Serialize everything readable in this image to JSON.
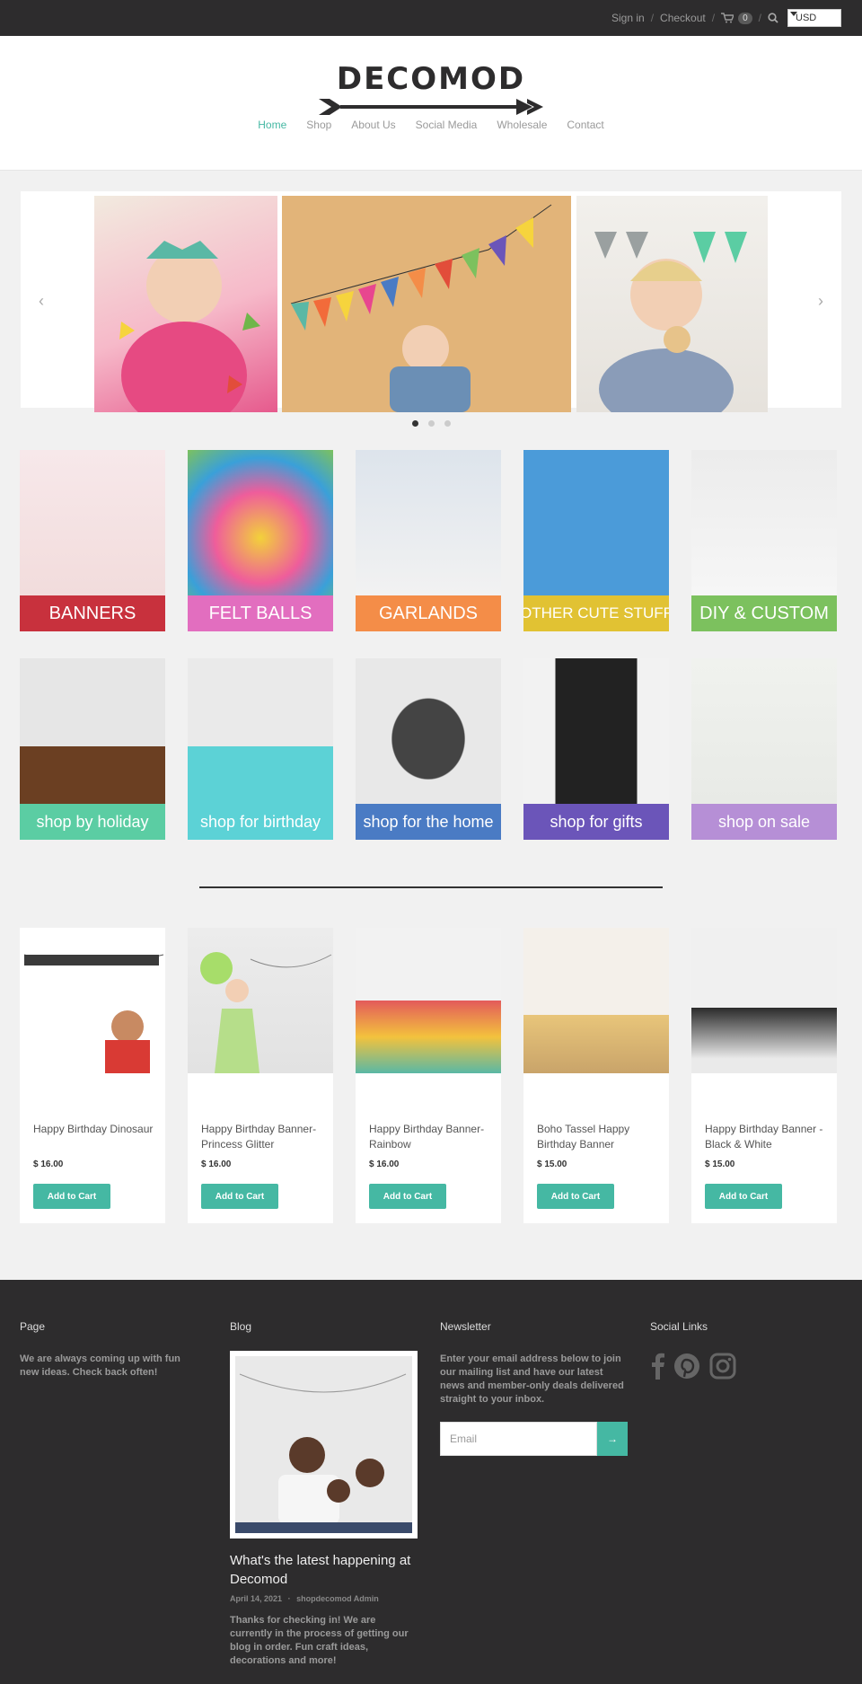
{
  "topbar": {
    "sign_in": "Sign in",
    "sep": "/",
    "checkout": "Checkout",
    "cart_count": "0",
    "currency": "USD"
  },
  "logo": {
    "text": "DECOMOD"
  },
  "nav": [
    "Home",
    "Shop",
    "About Us",
    "Social Media",
    "Wholesale",
    "Contact"
  ],
  "slider": {
    "prev": "‹",
    "next": "›"
  },
  "categories_row1": [
    {
      "label": "BANNERS",
      "color": "#c8313d"
    },
    {
      "label": "FELT BALLS",
      "color": "#e26ebf"
    },
    {
      "label": "GARLANDS",
      "color": "#f48d48"
    },
    {
      "label": "OTHER CUTE STUFF",
      "color": "#e1c233"
    },
    {
      "label": "DIY & CUSTOM",
      "color": "#7cc15e"
    }
  ],
  "categories_row2": [
    {
      "label": "shop by holiday",
      "color": "#5bcda3"
    },
    {
      "label": "shop for birthday",
      "color": "#5cd2d6"
    },
    {
      "label": "shop for the home",
      "color": "#4a7bc4"
    },
    {
      "label": "shop for gifts",
      "color": "#6b55b9"
    },
    {
      "label": "shop on sale",
      "color": "#b68fd6"
    }
  ],
  "products": [
    {
      "name": "Happy Birthday Dinosaur",
      "price": "$ 16.00",
      "button": "Add to Cart"
    },
    {
      "name": "Happy Birthday Banner- Princess Glitter",
      "price": "$ 16.00",
      "button": "Add to Cart"
    },
    {
      "name": "Happy Birthday Banner- Rainbow",
      "price": "$ 16.00",
      "button": "Add to Cart"
    },
    {
      "name": "Boho Tassel Happy Birthday Banner",
      "price": "$ 15.00",
      "button": "Add to Cart"
    },
    {
      "name": "Happy Birthday Banner - Black & White",
      "price": "$ 15.00",
      "button": "Add to Cart"
    }
  ],
  "footer": {
    "page": {
      "title": "Page",
      "text": "We are always coming up with fun new ideas. Check back often!"
    },
    "blog": {
      "title": "Blog",
      "post_title": "What's the latest happening at Decomod",
      "date": "April 14, 2021",
      "author": "shopdecomod Admin",
      "dot": "·",
      "excerpt": "Thanks for checking in!  We are currently in the process of getting our blog in order.  Fun craft ideas, decorations and more!"
    },
    "newsletter": {
      "title": "Newsletter",
      "text": "Enter your email address below to join our mailing list and have our latest news and member-only deals delivered straight to your inbox.",
      "placeholder": "Email",
      "submit": "→"
    },
    "social": {
      "title": "Social Links",
      "icons": [
        "facebook-icon",
        "pinterest-icon",
        "instagram-icon"
      ]
    }
  },
  "colors": {
    "accent": "#45b8a3",
    "dark": "#2d2c2d"
  }
}
